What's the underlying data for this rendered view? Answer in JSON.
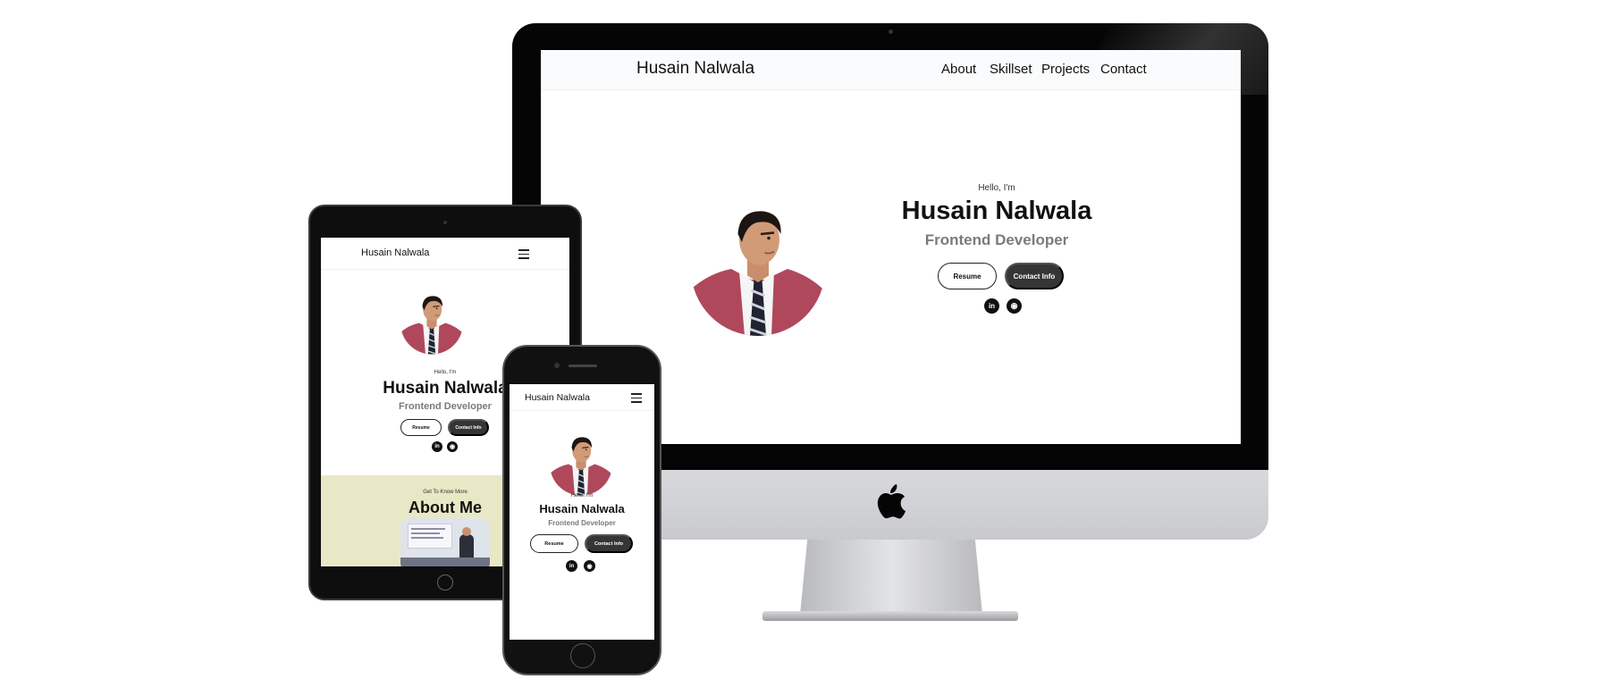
{
  "site": {
    "brand": "Husain Nalwala",
    "nav_links": [
      "About",
      "Skillset",
      "Projects",
      "Contact"
    ],
    "greeting": "Hello, I'm",
    "name": "Husain Nalwala",
    "role": "Frontend Developer",
    "resume_label": "Resume",
    "contact_label": "Contact Info",
    "social_icons": [
      "linkedin-icon",
      "github-icon"
    ]
  },
  "tablet_about": {
    "eyebrow": "Get To Know More",
    "heading": "About Me"
  },
  "colors": {
    "dark_button": "#353535",
    "about_band": "#e8e8c6",
    "role_text": "#7b7b7b",
    "blazer": "#b0485c"
  }
}
